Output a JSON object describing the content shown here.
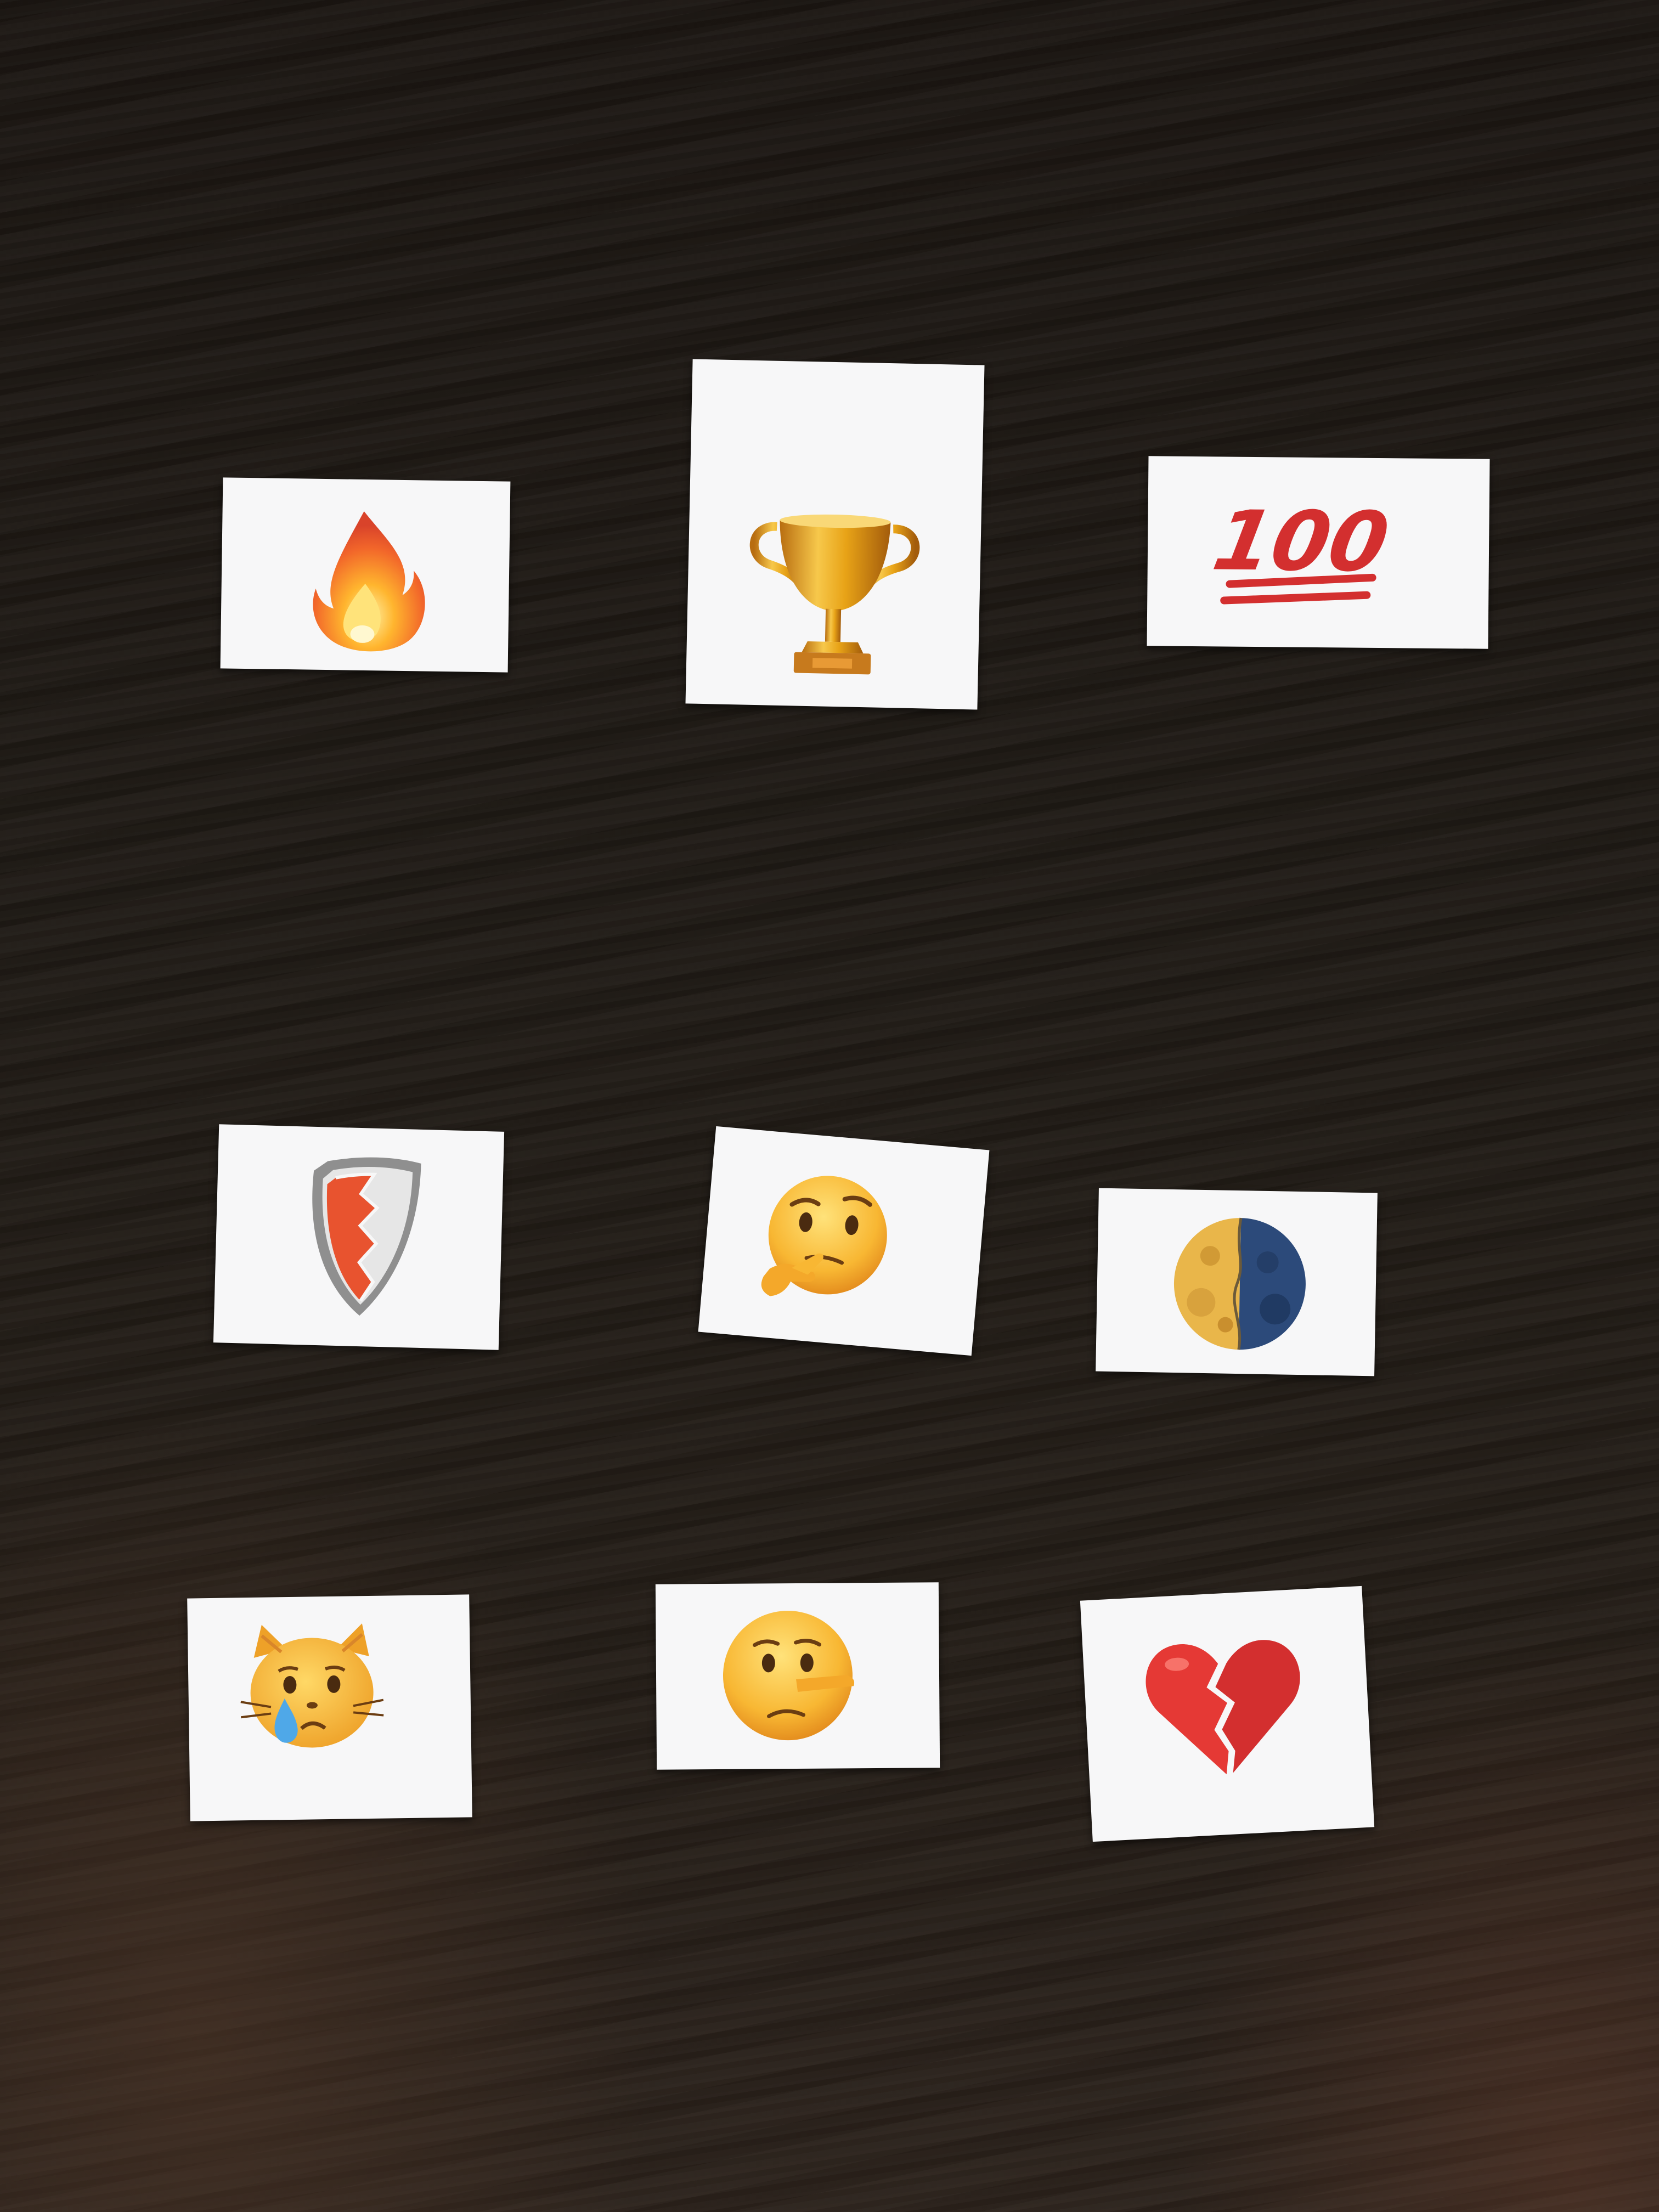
{
  "cards": [
    {
      "id": "fire",
      "icon": "fire-icon",
      "text": ""
    },
    {
      "id": "trophy",
      "icon": "trophy-icon",
      "text": ""
    },
    {
      "id": "hundred",
      "icon": "hundred-points-icon",
      "text": "100"
    },
    {
      "id": "shield",
      "icon": "shield-icon",
      "text": ""
    },
    {
      "id": "thinking",
      "icon": "thinking-face-icon",
      "text": ""
    },
    {
      "id": "moon",
      "icon": "last-quarter-moon-icon",
      "text": ""
    },
    {
      "id": "crying-cat",
      "icon": "crying-cat-face-icon",
      "text": ""
    },
    {
      "id": "lying-face",
      "icon": "lying-face-icon",
      "text": ""
    },
    {
      "id": "broken-heart",
      "icon": "broken-heart-icon",
      "text": ""
    }
  ],
  "colors": {
    "table": "#1f1a15",
    "card": "#f7f7f8",
    "emoji_red": "#d32f2f",
    "gold": "#e8a317"
  }
}
